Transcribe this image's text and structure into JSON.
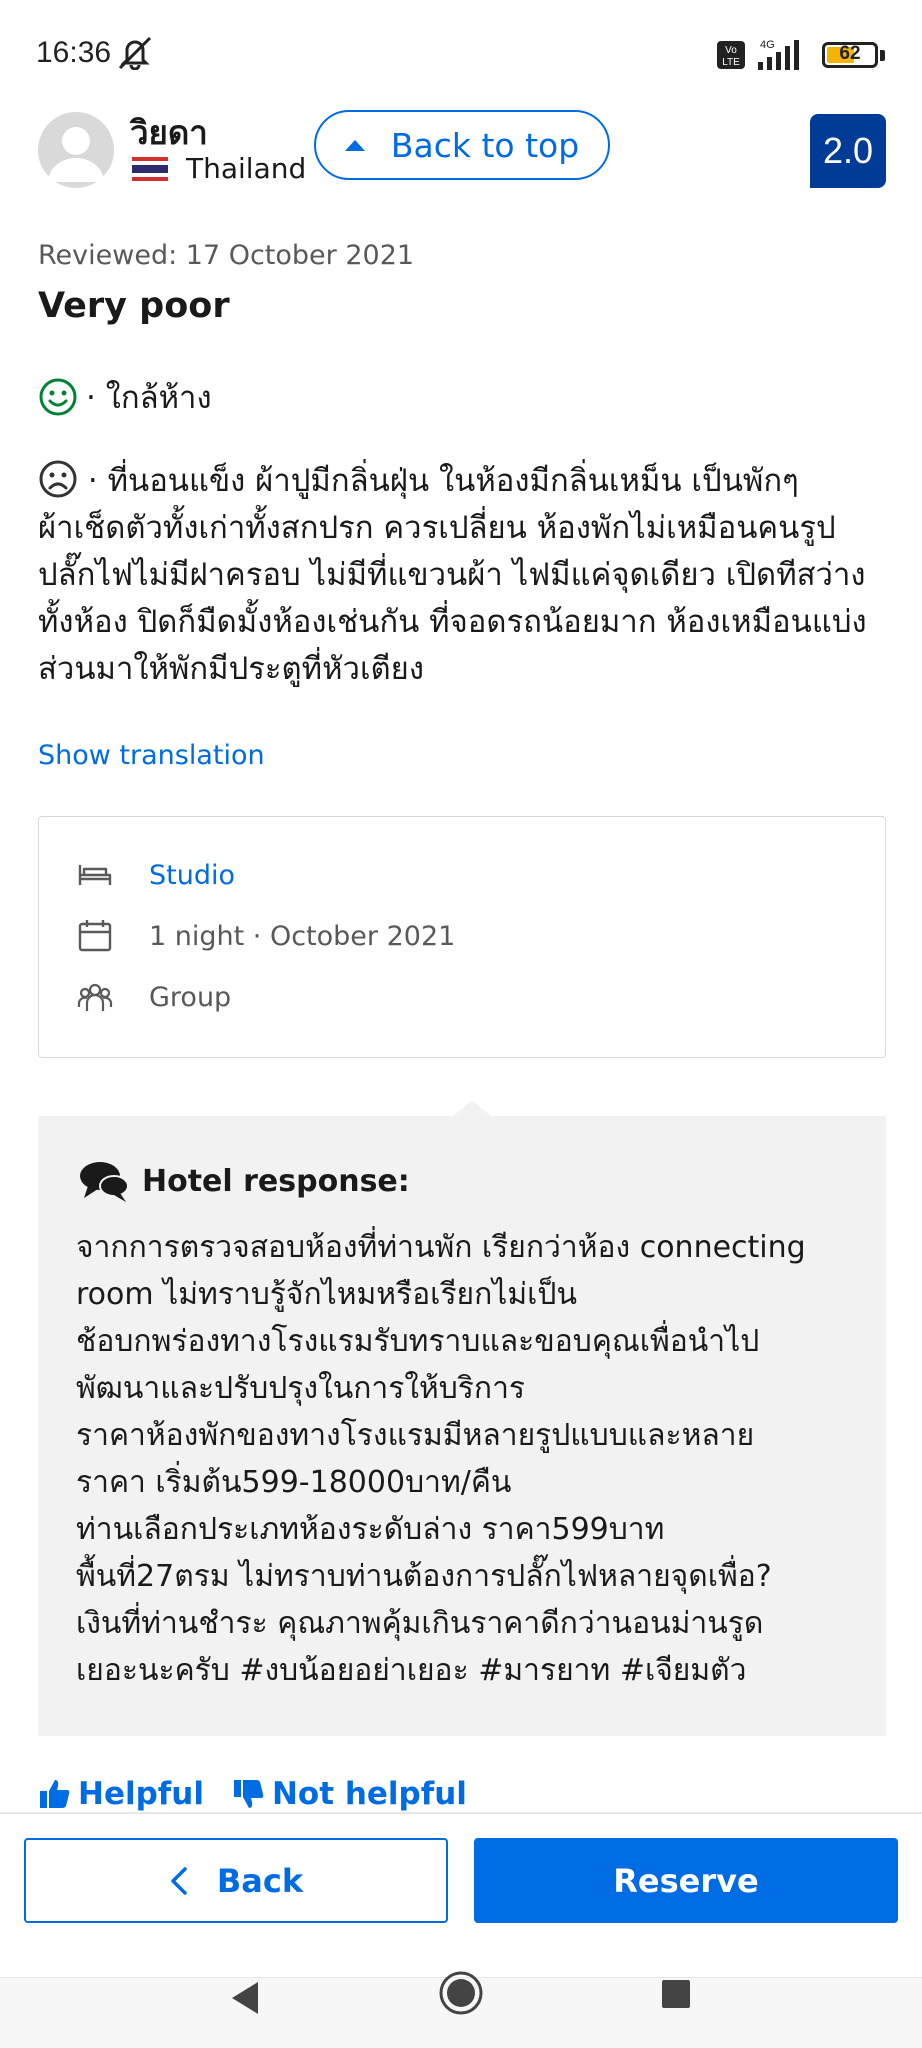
{
  "status_bar": {
    "time": "16:36",
    "battery_level": 62,
    "battery_label": "62",
    "icons": [
      "mute-icon",
      "volte-icon",
      "signal-4g-icon",
      "battery-icon"
    ]
  },
  "reviewer": {
    "name": "วิยดา",
    "country": "Thailand",
    "flag_icon": "thailand-flag-icon"
  },
  "back_to_top_label": "Back to top",
  "score": "2.0",
  "review": {
    "reviewed_date": "Reviewed: 17 October 2021",
    "title": "Very poor",
    "positive": "· ใกล้ห้าง",
    "negative": "· ที่นอนแข็ง ผ้าปูมีกลิ่นฝุ่น ในห้องมีกลิ่นเหม็น เป็นพักๆ ผ้าเช็ดตัวทั้งเก่าทั้งสกปรก ควรเปลี่ยน ห้องพักไม่เหมือนคนรูป ปลั๊กไฟไม่มีฝาครอบ ไม่มีที่แขวนผ้า ไฟมีแค่จุดเดียว เปิดทีสว่างทั้งห้อง ปิดก็มืดมั้งห้องเช่นกัน ที่จอดรถน้อยมาก ห้องเหมือนแบ่งส่วนมาให้พักมีประตูที่หัวเตียง",
    "show_translation": "Show translation"
  },
  "stay": {
    "room": "Studio",
    "duration": "1 night · October 2021",
    "traveler_type": "Group"
  },
  "hotel_response": {
    "title": "Hotel response:",
    "lines": [
      "จากการตรวจสอบห้องที่ท่านพัก เรียกว่าห้อง connecting",
      "room ไม่ทราบรู้จักไหมหรือเรียกไม่เป็น",
      "ช้อบกพร่องทางโรงแรมรับทราบและขอบคุณเพื่อนำไป",
      "พัฒนาและปรับปรุงในการให้บริการ",
      "ราคาห้องพักของทางโรงแรมมีหลายรูปแบบและหลาย",
      "ราคา เริ่มต้น599-18000บาท/คืน",
      "ท่านเลือกประเภทห้องระดับล่าง ราคา599บาท",
      "พื้นที่27ตรม ไม่ทราบท่านต้องการปลั๊กไฟหลายจุดเพื่อ?",
      "เงินที่ท่านชำระ คุณภาพคุ้มเกินราคาดีกว่านอนม่านรูด",
      "เยอะนะครับ #งบน้อยอย่าเยอะ #มารยาท #เจียมตัว"
    ]
  },
  "feedback": {
    "helpful": "Helpful",
    "not_helpful": "Not helpful"
  },
  "bottom_bar": {
    "back": "Back",
    "reserve": "Reserve"
  },
  "colors": {
    "brand_blue": "#006ce4",
    "score_navy": "#003b95",
    "positive_green": "#008234",
    "response_bg": "#f2f2f2"
  }
}
